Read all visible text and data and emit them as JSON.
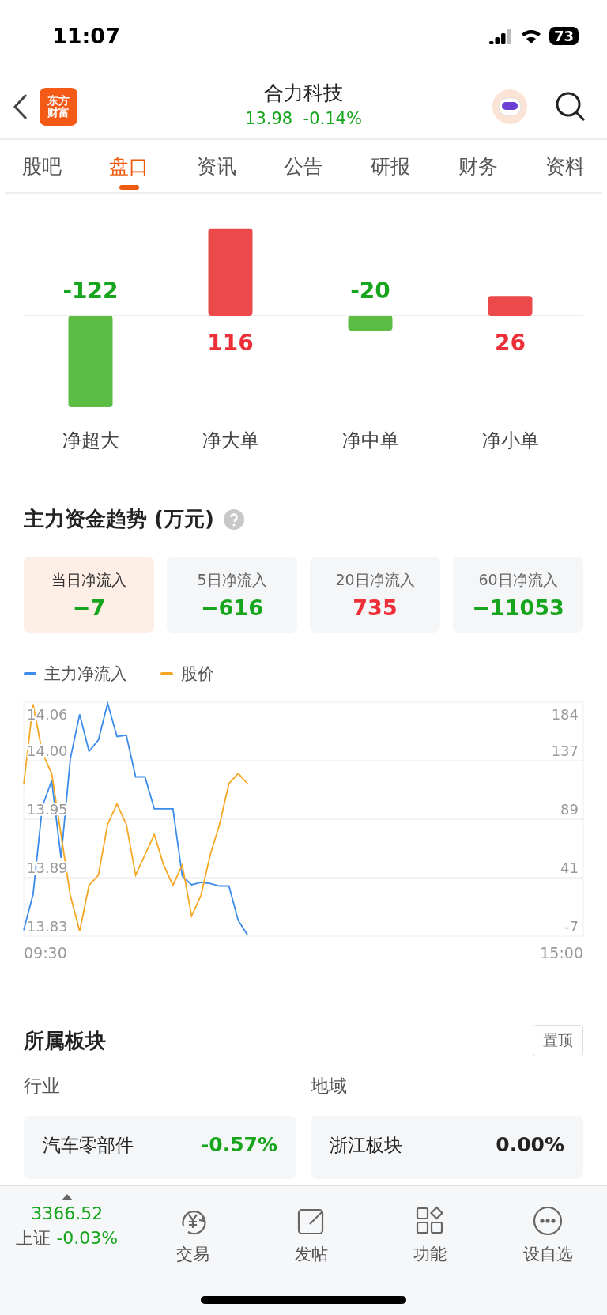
{
  "status_bar": {
    "time": "11:07",
    "battery": "73"
  },
  "header": {
    "logo": [
      "东方",
      "财富"
    ],
    "title": "合力科技",
    "price": "13.98",
    "change": "-0.14%"
  },
  "tabs": [
    {
      "label": "股吧",
      "selected": false
    },
    {
      "label": "盘口",
      "selected": true
    },
    {
      "label": "资讯",
      "selected": false
    },
    {
      "label": "公告",
      "selected": false
    },
    {
      "label": "研报",
      "selected": false
    },
    {
      "label": "财务",
      "selected": false
    },
    {
      "label": "资料",
      "selected": false
    }
  ],
  "order_flow": {
    "chart_data": {
      "type": "bar",
      "categories": [
        "净超大",
        "净大单",
        "净中单",
        "净小单"
      ],
      "values": [
        -122,
        116,
        -20,
        26
      ],
      "data_labels": true
    }
  },
  "trend": {
    "title": "主力资金趋势 (万元)",
    "cards": [
      {
        "label": "当日净流入",
        "value": "−7",
        "selected": true,
        "color": "#16a51c"
      },
      {
        "label": "5日净流入",
        "value": "−616",
        "selected": false,
        "color": "#16a51c"
      },
      {
        "label": "20日净流入",
        "value": "735",
        "selected": false,
        "color": "#ee2f37"
      },
      {
        "label": "60日净流入",
        "value": "−11053",
        "selected": false,
        "color": "#16a51c"
      }
    ],
    "trend_chart": {
      "legend": [
        {
          "name": "主力净流入",
          "color": "#3b8beb"
        },
        {
          "name": "股价",
          "color": "#f5a623"
        }
      ],
      "left_axis": [
        "14.06",
        "14.00",
        "13.95",
        "13.89",
        "13.83"
      ],
      "right_axis": [
        "184",
        "137",
        "89",
        "41",
        "-7"
      ],
      "time_axis": [
        "09:30",
        "15:00"
      ]
    }
  },
  "sectors": {
    "title": "所属板块",
    "pin_button": "置顶",
    "groups": [
      {
        "label": "行业",
        "name": "汽车零部件",
        "change": "-0.57%",
        "color": "#16a51c"
      },
      {
        "label": "地域",
        "name": "浙江板块",
        "change": "0.00%",
        "color": "#222222"
      }
    ]
  },
  "bottom_bar": {
    "index_value": "3366.52",
    "index_name": "上证",
    "index_change": "-0.03%",
    "items": [
      {
        "kind": "trade",
        "label": "交易"
      },
      {
        "kind": "post",
        "label": "发帖"
      },
      {
        "kind": "functions",
        "label": "功能"
      },
      {
        "kind": "more",
        "label": "设自选"
      }
    ]
  }
}
